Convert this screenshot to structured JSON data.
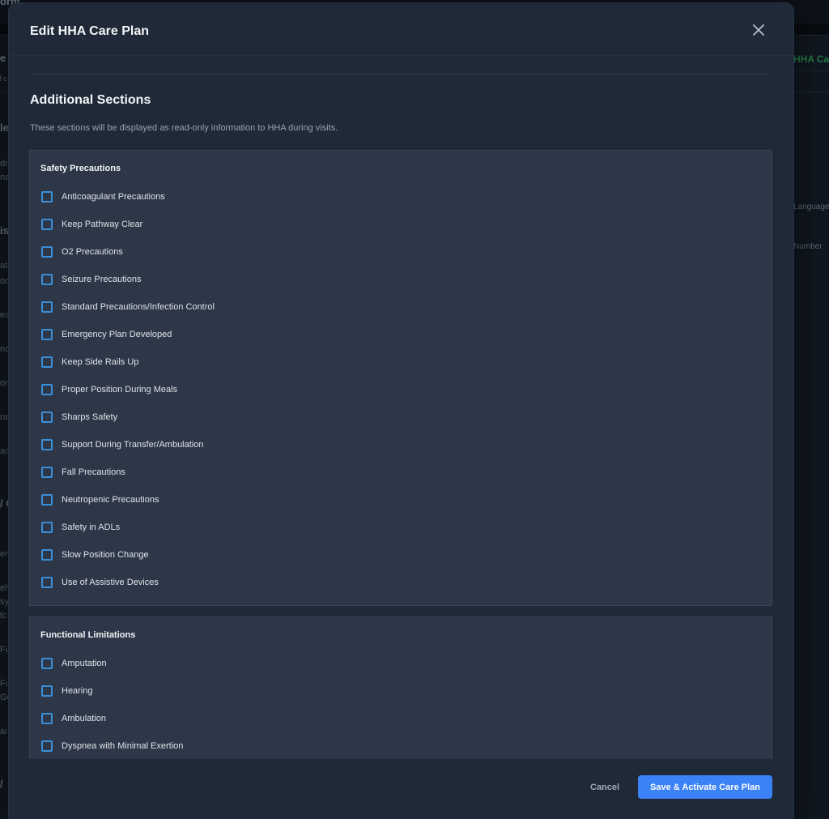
{
  "background": {
    "fragments": [
      "orm",
      "e",
      "of c",
      "le",
      "dr",
      "na",
      "is",
      "ati",
      "oo",
      "ea",
      "no",
      "or",
      "ra",
      "ac",
      "/ C",
      "en",
      "eh",
      "sy",
      "tc",
      "Fu",
      "Fu",
      "Go",
      "ai",
      "/",
      "HHA Care",
      "Language",
      "Number"
    ]
  },
  "modal": {
    "title": "Edit HHA Care Plan",
    "close_icon": "close-icon",
    "section_title": "Additional Sections",
    "section_desc": "These sections will be displayed as read-only information to HHA during visits.",
    "groups": [
      {
        "title": "Safety Precautions",
        "items": [
          {
            "label": "Anticoagulant Precautions",
            "checked": false
          },
          {
            "label": "Keep Pathway Clear",
            "checked": false
          },
          {
            "label": "O2 Precautions",
            "checked": false
          },
          {
            "label": "Seizure Precautions",
            "checked": false
          },
          {
            "label": "Standard Precautions/Infection Control",
            "checked": false
          },
          {
            "label": "Emergency Plan Developed",
            "checked": false
          },
          {
            "label": "Keep Side Rails Up",
            "checked": false
          },
          {
            "label": "Proper Position During Meals",
            "checked": false
          },
          {
            "label": "Sharps Safety",
            "checked": false
          },
          {
            "label": "Support During Transfer/Ambulation",
            "checked": false
          },
          {
            "label": "Fall Precautions",
            "checked": false
          },
          {
            "label": "Neutropenic Precautions",
            "checked": false
          },
          {
            "label": "Safety in ADLs",
            "checked": false
          },
          {
            "label": "Slow Position Change",
            "checked": false
          },
          {
            "label": "Use of Assistive Devices",
            "checked": false
          }
        ]
      },
      {
        "title": "Functional Limitations",
        "items": [
          {
            "label": "Amputation",
            "checked": false
          },
          {
            "label": "Hearing",
            "checked": false
          },
          {
            "label": "Ambulation",
            "checked": false
          },
          {
            "label": "Dyspnea with Minimal Exertion",
            "checked": false
          }
        ]
      }
    ],
    "footer": {
      "cancel_label": "Cancel",
      "save_label": "Save & Activate Care Plan"
    }
  },
  "colors": {
    "accent": "#3b82f6",
    "checkbox_border": "#3b8fd9",
    "modal_bg": "#1f2937",
    "card_bg": "#2d3747",
    "green_text": "#1f7a45"
  }
}
